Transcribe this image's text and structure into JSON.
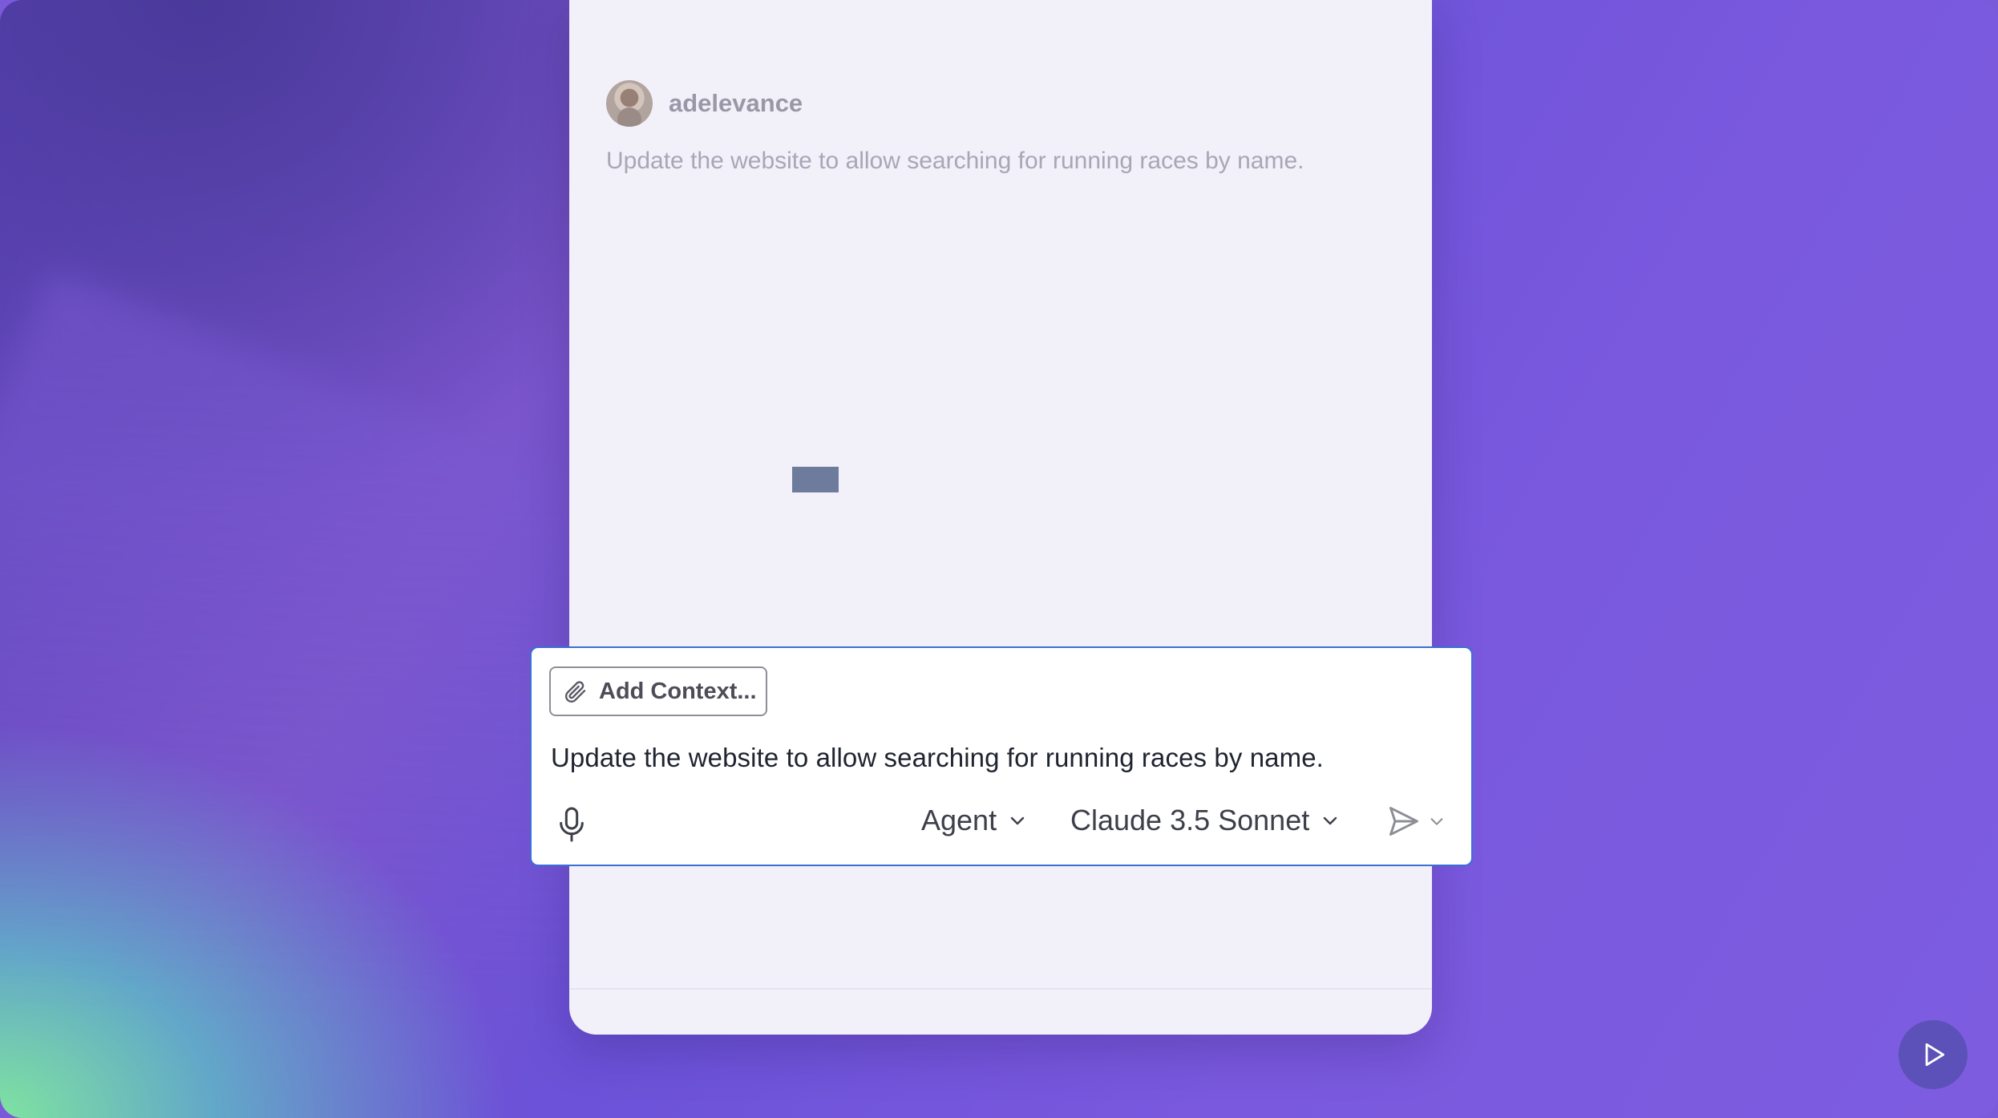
{
  "chat": {
    "username": "adelevance",
    "message": "Update the website to allow searching for running races by name."
  },
  "composer": {
    "add_context_label": "Add Context...",
    "input_value": "Update the website to allow searching for running races by name.",
    "mode_label": "Agent",
    "model_label": "Claude 3.5 Sonnet"
  },
  "icons": {
    "attach": "paperclip-icon",
    "mic": "microphone-icon",
    "send": "send-icon",
    "play": "play-icon"
  },
  "colors": {
    "composer_border": "#3b6fd6",
    "play_button": "#5c51b8"
  }
}
